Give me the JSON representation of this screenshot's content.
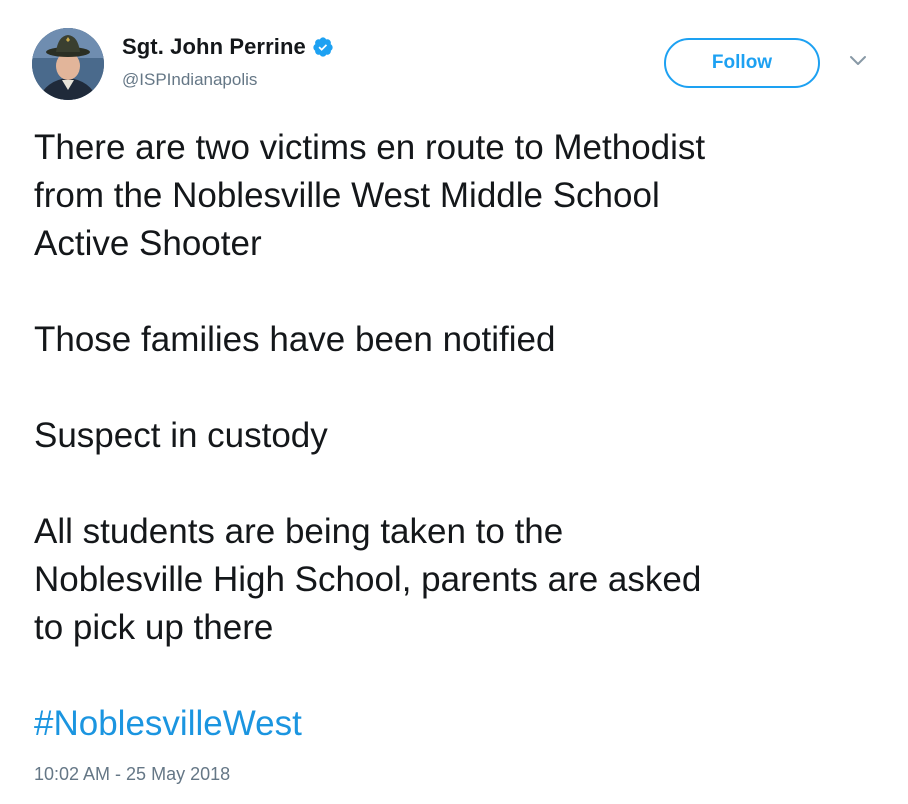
{
  "user": {
    "display_name": "Sgt. John Perrine",
    "handle": "@ISPIndianapolis",
    "verified": true
  },
  "actions": {
    "follow_label": "Follow"
  },
  "tweet": {
    "paragraphs": [
      [
        "There are two victims en route to Methodist",
        "from the Noblesville West Middle School",
        "Active Shooter"
      ],
      [
        "Those families have been notified"
      ],
      [
        "Suspect in custody"
      ],
      [
        "All students are being taken to the",
        "Noblesville High School, parents are asked",
        "to pick up there"
      ]
    ],
    "hashtag": "#NoblesvilleWest",
    "timestamp": "10:02 AM - 25 May 2018"
  },
  "colors": {
    "accent": "#1da1f2",
    "link": "#1b95e0",
    "text": "#14171a",
    "secondary_text": "#657786"
  },
  "icons": {
    "verified": "verified-badge-icon",
    "more": "chevron-down-icon"
  }
}
